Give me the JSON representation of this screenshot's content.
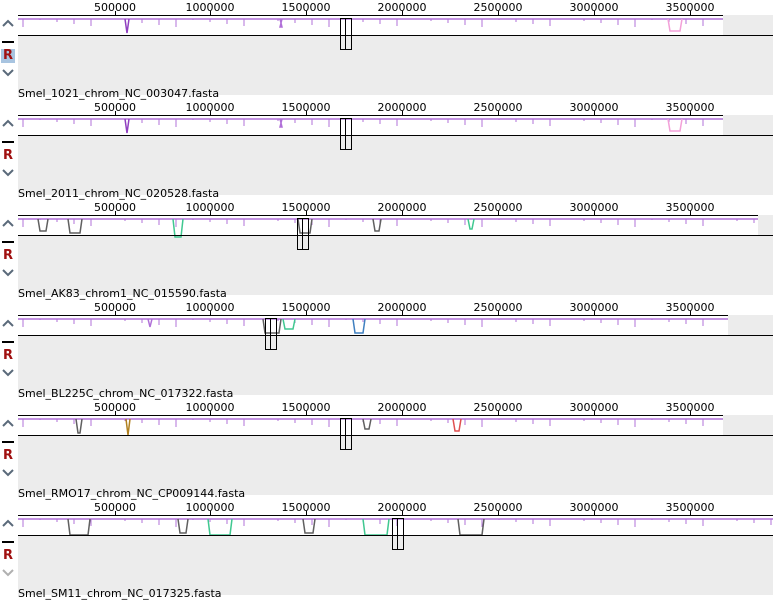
{
  "colors": {
    "sequence_line": "#b070d8",
    "highlight_pink": "#f3a0d8",
    "block_green": "#40c890",
    "ruler_tick": "#000000",
    "button_red": "#a01010",
    "selected_r_bg": "#a8c4e0"
  },
  "tick_labels": [
    "500000",
    "1000000",
    "1500000",
    "2000000",
    "2500000",
    "3000000",
    "3500000"
  ],
  "panels": [
    {
      "name": "Smel_1021_chrom_NC_003047.fasta",
      "selected": true
    },
    {
      "name": "Smel_2011_chrom_NC_020528.fasta",
      "selected": false
    },
    {
      "name": "Smel_AK83_chrom1_NC_015590.fasta",
      "selected": false
    },
    {
      "name": "Smel_BL225C_chrom_NC_017322.fasta",
      "selected": false
    },
    {
      "name": "Smel_RMO17_chrom_NC_CP009144.fasta",
      "selected": false
    },
    {
      "name": "Smel_SM11_chrom_NC_017325.fasta",
      "selected": false
    }
  ],
  "controls": {
    "reverse_label": "R"
  }
}
